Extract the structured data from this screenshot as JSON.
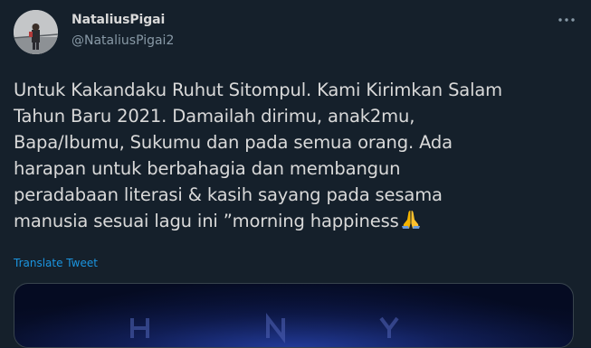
{
  "user": {
    "display_name": "NataliusPigai",
    "handle": "@NataliusPigai2"
  },
  "tweet": {
    "text": "Untuk Kakandaku Ruhut Sitompul. Kami Kirimkan Salam\nTahun Baru 2021. Damailah dirimu, anak2mu,\nBapa/Ibumu, Sukumu dan pada semua orang. Ada\nharapan untuk berbahagia dan membangun\nperadabaan literasi & kasih sayang pada sesama\nmanusia sesuai lagu ini ”morning happiness",
    "emoji_icon": "folded-hands-icon",
    "translate_label": "Translate Tweet"
  },
  "icons": {
    "more": "more-icon",
    "avatar": "avatar"
  },
  "colors": {
    "background": "#15202b",
    "text": "#d9d9d9",
    "secondary": "#8899a6",
    "link": "#1b95e0"
  }
}
